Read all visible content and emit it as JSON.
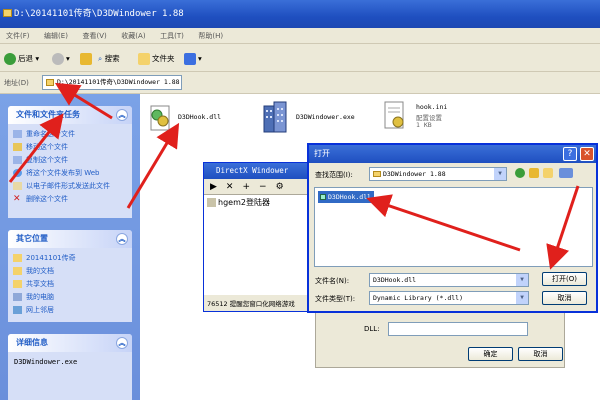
{
  "window": {
    "title": "D:\\20141101传奇\\D3DWindower 1.88"
  },
  "menu": [
    "文件(F)",
    "编辑(E)",
    "查看(V)",
    "收藏(A)",
    "工具(T)",
    "帮助(H)"
  ],
  "toolbar": {
    "back": "后退",
    "search": "搜索",
    "folders": "文件夹"
  },
  "address": {
    "label": "地址(D)",
    "value": "D:\\20141101传奇\\D3DWindower 1.88"
  },
  "tasks": {
    "title": "文件和文件夹任务",
    "items": [
      "重命名这个文件",
      "移动这个文件",
      "复制这个文件",
      "将这个文件发布到 Web",
      "以电子邮件形式发送此文件",
      "删除这个文件"
    ]
  },
  "places": {
    "title": "其它位置",
    "items": [
      "20141101传奇",
      "我的文档",
      "共享文档",
      "我的电脑",
      "网上邻居"
    ]
  },
  "details": {
    "title": "详细信息",
    "name": "D3DWindower.exe"
  },
  "files": [
    {
      "name": "D3DHook.dll"
    },
    {
      "name": "D3DWindower.exe"
    },
    {
      "name": "hook.ini",
      "line2": "配置设置",
      "line3": "1 KB"
    }
  ],
  "dx_window": {
    "title": "DirectX Windower",
    "item": "hgem2登陆器",
    "status": "76512 提醒您窗口化网络游戏"
  },
  "open_dialog": {
    "title": "打开",
    "look_in_label": "查找范围(I):",
    "look_in_value": "D3DWindower 1.88",
    "selected_file": "D3DHook.dll",
    "filename_label": "文件名(N):",
    "filename_value": "D3DHook.dll",
    "filetype_label": "文件类型(T):",
    "filetype_value": "Dynamic Library (*.dll)",
    "open_button": "打开(O)",
    "cancel_button": "取消"
  },
  "bg_dialog": {
    "dll_label": "DLL:",
    "ok_button": "确定",
    "cancel_button": "取消"
  },
  "colors": {
    "arrow": "#e0201c",
    "selection": "#316ac5",
    "titlebar": "#1f4fc0"
  }
}
